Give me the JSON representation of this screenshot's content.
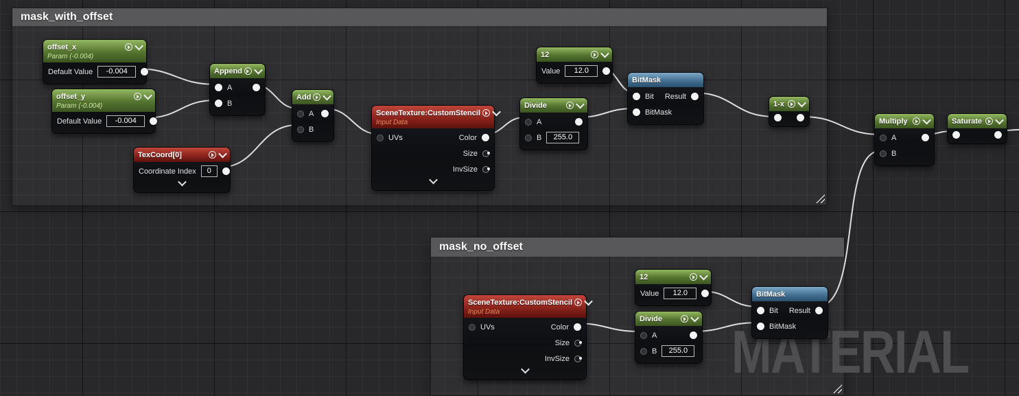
{
  "comments": {
    "c1": {
      "title": "mask_with_offset"
    },
    "c2": {
      "title": "mask_no_offset"
    }
  },
  "nodes": {
    "offset_x": {
      "title": "offset_x",
      "subtitle": "Param (-0.004)",
      "field": "Default Value",
      "value": "-0.004"
    },
    "offset_y": {
      "title": "offset_y",
      "subtitle": "Param (-0.004)",
      "field": "Default Value",
      "value": "-0.004"
    },
    "texcoord": {
      "title": "TexCoord[0]",
      "field": "Coordinate Index",
      "value": "0"
    },
    "append": {
      "title": "Append",
      "a": "A",
      "b": "B"
    },
    "add": {
      "title": "Add",
      "a": "A",
      "b": "B"
    },
    "scene1": {
      "title": "SceneTexture:CustomStencil",
      "subtitle": "Input Data",
      "uvs": "UVs",
      "color": "Color",
      "size": "Size",
      "invsize": "InvSize"
    },
    "const1": {
      "title": "12",
      "field": "Value",
      "value": "12.0"
    },
    "divide1": {
      "title": "Divide",
      "a": "A",
      "b": "B",
      "b_value": "255.0"
    },
    "bitmask1": {
      "title": "BitMask",
      "bit": "Bit",
      "mask": "BitMask",
      "result": "Result"
    },
    "oneminusx": {
      "title": "1-x"
    },
    "multiply": {
      "title": "Multiply",
      "a": "A",
      "b": "B"
    },
    "saturate": {
      "title": "Saturate"
    },
    "scene2": {
      "title": "SceneTexture:CustomStencil",
      "subtitle": "Input Data",
      "uvs": "UVs",
      "color": "Color",
      "size": "Size",
      "invsize": "InvSize"
    },
    "const2": {
      "title": "12",
      "field": "Value",
      "value": "12.0"
    },
    "divide2": {
      "title": "Divide",
      "a": "A",
      "b": "B",
      "b_value": "255.0"
    },
    "bitmask2": {
      "title": "BitMask",
      "bit": "Bit",
      "mask": "BitMask",
      "result": "Result"
    }
  },
  "watermark": "MATERIAL",
  "colors": {
    "background": "#28282b",
    "comment_header": "#58585a",
    "node_header_green": "#7da757",
    "node_header_red": "#b43a31",
    "node_header_blue": "#6f9cc0",
    "wire": "#dedede",
    "watermark": "#4e4e50"
  }
}
